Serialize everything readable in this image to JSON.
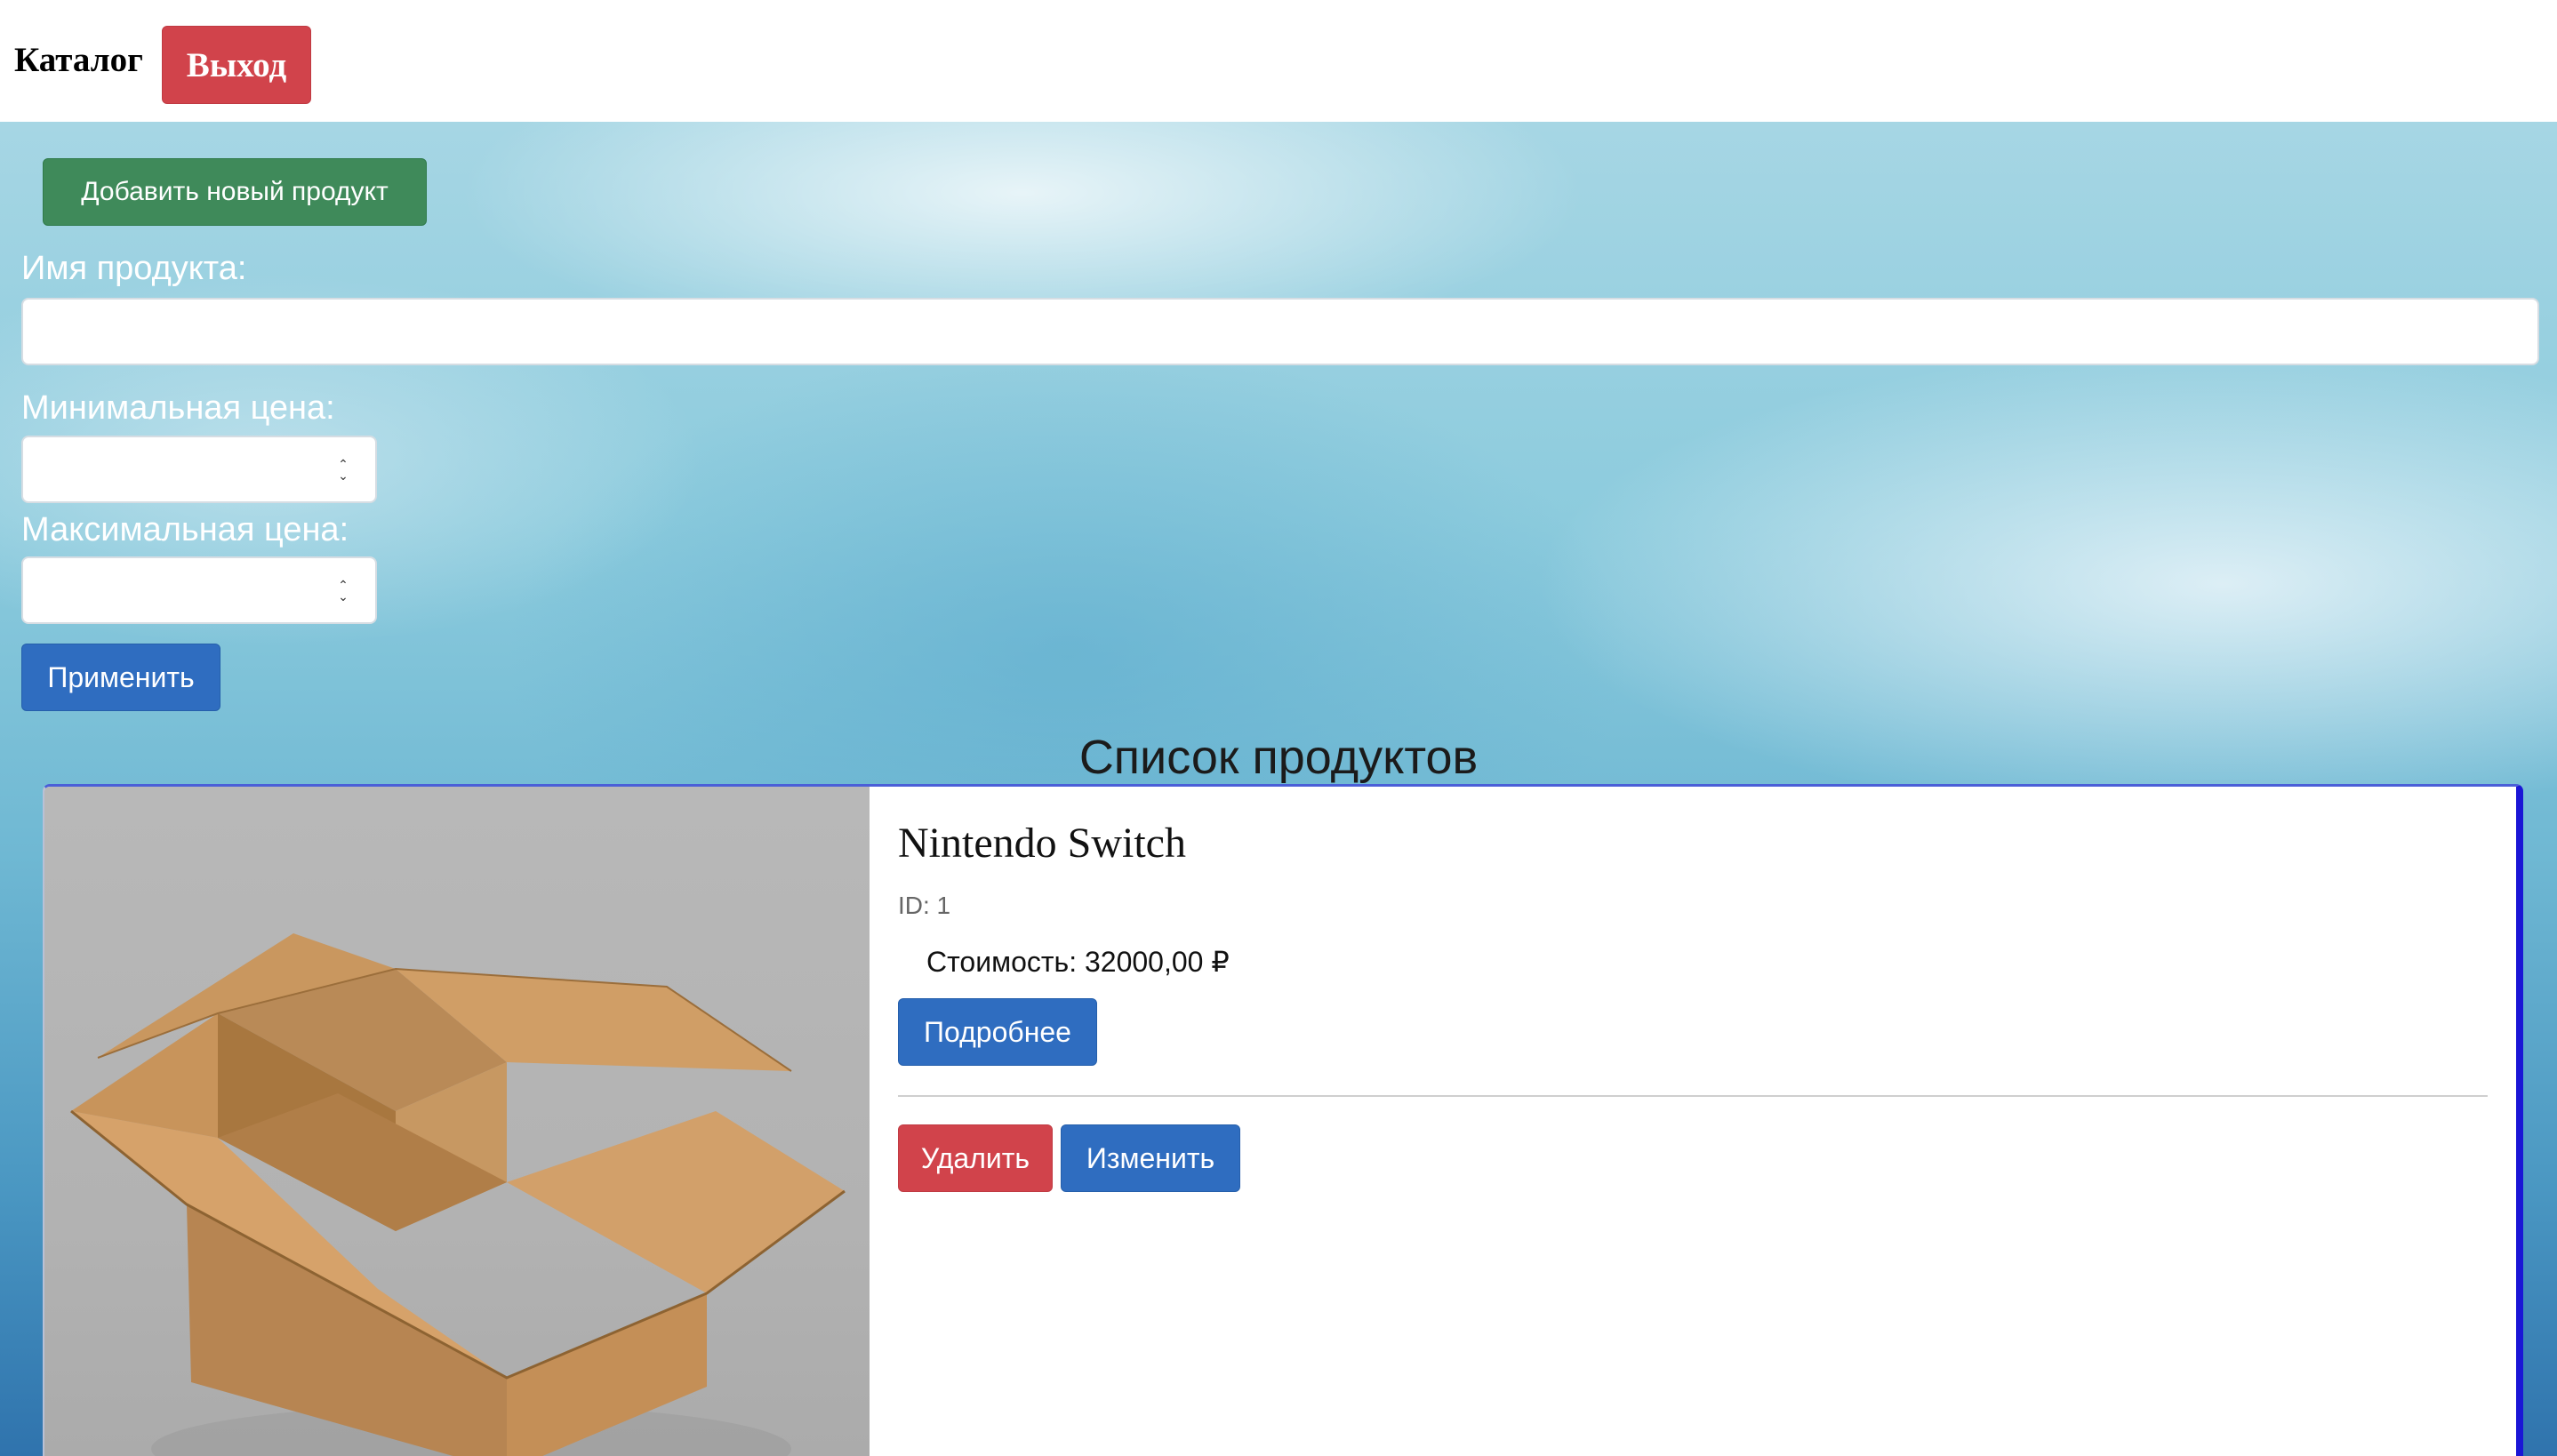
{
  "header": {
    "brand": "Каталог",
    "logout_label": "Выход"
  },
  "filters": {
    "add_label": "Добавить новый продукт",
    "name_label": "Имя продукта:",
    "name_value": "",
    "min_label": "Минимальная цена:",
    "min_value": "",
    "max_label": "Максимальная цена:",
    "max_value": "",
    "apply_label": "Применить"
  },
  "list": {
    "title": "Список продуктов",
    "products": [
      {
        "name": "Nintendo Switch",
        "id_text": "ID: 1",
        "price_text": "Стоимость: 32000,00 ₽",
        "details_label": "Подробнее",
        "delete_label": "Удалить",
        "edit_label": "Изменить",
        "image_icon": "cardboard-box-image"
      }
    ]
  },
  "colors": {
    "danger": "#d1434b",
    "success": "#3f8a5a",
    "primary": "#2f6dc0",
    "card_accent": "#1a16d6"
  }
}
